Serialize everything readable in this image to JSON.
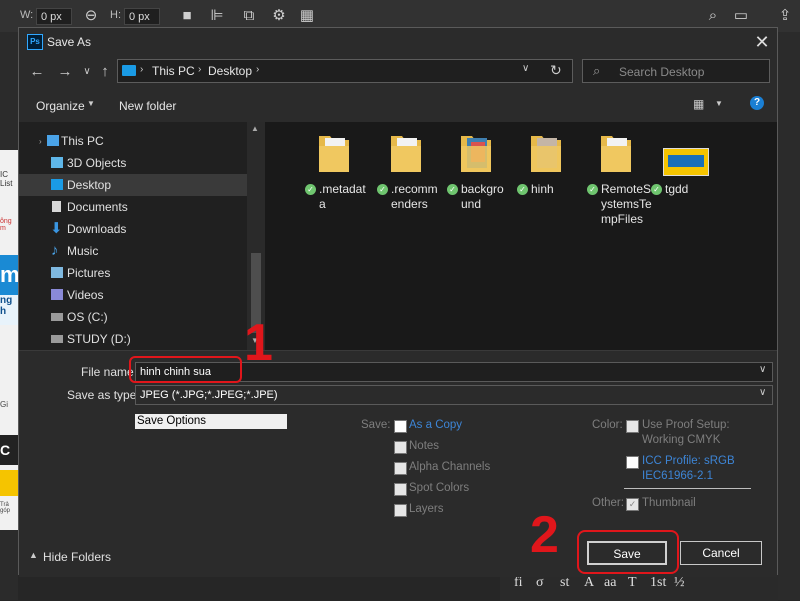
{
  "photoshop": {
    "width_label": "W:",
    "width_value": "0 px",
    "height_label": "H:",
    "height_value": "0 px",
    "doc_strip": [
      "IC List",
      "ông m",
      "m",
      "ng h",
      "Gi",
      "C",
      "Trả góp"
    ],
    "bottom_tools": [
      "fi",
      "σ",
      "st",
      "A",
      "aa",
      "T",
      "1st",
      "½"
    ]
  },
  "dialog": {
    "title": "Save As",
    "close_icon": "close-icon",
    "breadcrumb": [
      "This PC",
      "Desktop"
    ],
    "search_placeholder": "Search Desktop",
    "toolbar": {
      "organize": "Organize",
      "new_folder": "New folder",
      "help": "?"
    },
    "nav_items": [
      {
        "label": "This PC",
        "icon": "pc-icon"
      },
      {
        "label": "3D Objects",
        "icon": "cube-icon"
      },
      {
        "label": "Desktop",
        "icon": "desktop-icon",
        "selected": true
      },
      {
        "label": "Documents",
        "icon": "document-icon"
      },
      {
        "label": "Downloads",
        "icon": "download-icon"
      },
      {
        "label": "Music",
        "icon": "music-icon"
      },
      {
        "label": "Pictures",
        "icon": "pictures-icon"
      },
      {
        "label": "Videos",
        "icon": "video-icon"
      },
      {
        "label": "OS (C:)",
        "icon": "drive-icon"
      },
      {
        "label": "STUDY (D:)",
        "icon": "drive-icon"
      }
    ],
    "files": [
      {
        "name": ".metadata",
        "lines": [
          ".metadat",
          "a"
        ]
      },
      {
        "name": ".recommenders",
        "lines": [
          ".recomm",
          "enders"
        ]
      },
      {
        "name": "background",
        "lines": [
          "backgro",
          "und"
        ]
      },
      {
        "name": "hinh",
        "lines": [
          "hinh"
        ]
      },
      {
        "name": "RemoteSystemsTempFiles",
        "lines": [
          "RemoteS",
          "ystemsTe",
          "mpFiles"
        ]
      },
      {
        "name": "tgdd",
        "lines": [
          "tgdd"
        ]
      }
    ],
    "file_name_label": "File name",
    "file_name_value": "hinh chinh sua",
    "save_type_label": "Save as type:",
    "save_type_value": "JPEG (*.JPG;*.JPEG;*.JPE)",
    "save_options": "Save Options",
    "save_label": "Save:",
    "save_opts": [
      "As a Copy",
      "Notes",
      "Alpha Channels",
      "Spot Colors",
      "Layers"
    ],
    "color_label": "Color:",
    "color_opts": [
      [
        "Use Proof Setup:",
        "Working CMYK"
      ],
      [
        "ICC Profile:  sRGB",
        "IEC61966-2.1"
      ]
    ],
    "other_label": "Other:",
    "thumbnail": "Thumbnail",
    "hide_folders": "Hide Folders",
    "save_button": "Save",
    "cancel_button": "Cancel"
  },
  "annotations": {
    "step1": "1",
    "step2": "2",
    "color": "#e0161b"
  },
  "colors": {
    "accent": "#31a8ff",
    "link": "#3d85d6",
    "selected": "#3a3a3a"
  }
}
